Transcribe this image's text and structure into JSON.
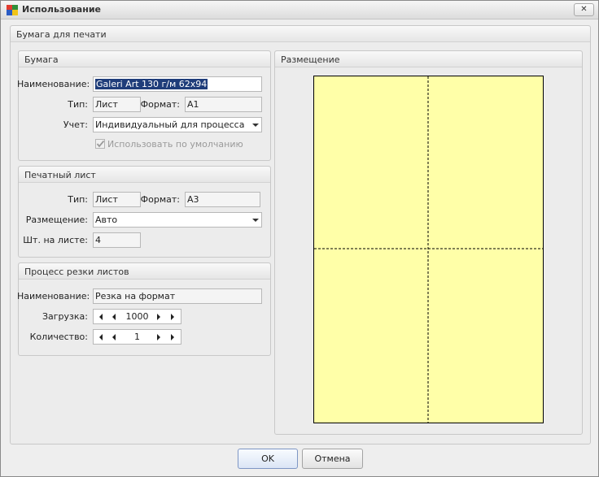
{
  "window": {
    "title": "Использование",
    "close_label": "✕"
  },
  "main_group": {
    "title": "Бумага для печати"
  },
  "paper": {
    "title": "Бумага",
    "name_label": "Наименование:",
    "name_value": "Galeri Art 130 г/м 62x94",
    "type_label": "Тип:",
    "type_value": "Лист",
    "format_label": "Формат:",
    "format_value": "A1",
    "account_label": "Учет:",
    "account_value": "Индивидуальный для процесса",
    "default_label": "Использовать по умолчанию",
    "default_checked": true
  },
  "print_sheet": {
    "title": "Печатный лист",
    "type_label": "Тип:",
    "type_value": "Лист",
    "format_label": "Формат:",
    "format_value": "A3",
    "placement_label": "Размещение:",
    "placement_value": "Авто",
    "count_label": "Шт. на листе:",
    "count_value": "4"
  },
  "cutting": {
    "title": "Процесс резки листов",
    "name_label": "Наименование:",
    "name_value": "Резка на формат",
    "load_label": "Загрузка:",
    "load_value": "1000",
    "qty_label": "Количество:",
    "qty_value": "1"
  },
  "placement_preview": {
    "title": "Размещение",
    "sheet_color": "#ffffa8",
    "columns": 2,
    "rows": 2
  },
  "buttons": {
    "ok": "OK",
    "cancel": "Отмена"
  }
}
